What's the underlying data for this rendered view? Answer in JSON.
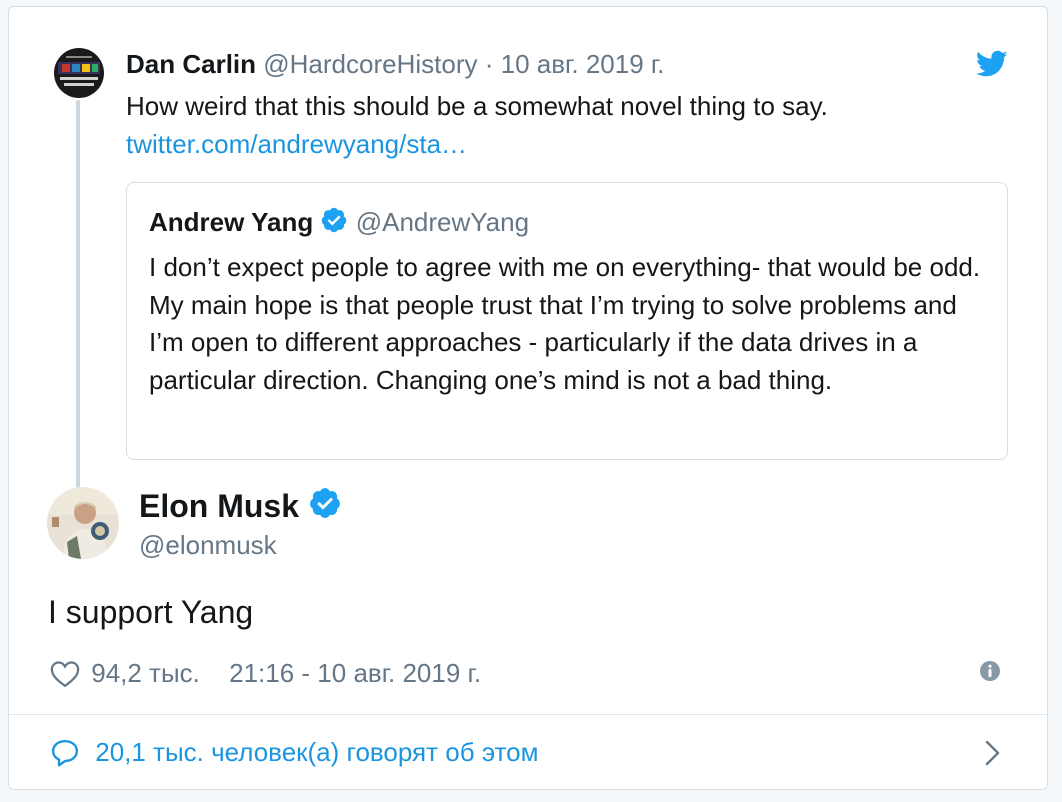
{
  "quoted_reply": {
    "author_name": "Dan Carlin",
    "author_handle": "@HardcoreHistory",
    "separator": "·",
    "date": "10 авг. 2019 г.",
    "text": "How weird that this should be a somewhat novel thing to say.",
    "link": "twitter.com/andrewyang/sta…",
    "avatar_icon": "hardcore-history-logo"
  },
  "quote": {
    "author_name": "Andrew Yang",
    "author_handle": "@AndrewYang",
    "verified": true,
    "text": "I don’t expect people to agree with me on everything- that would be odd. My main hope is that people trust that I’m trying to solve problems and I’m open to different approaches - particularly if the data drives in a particular direction. Changing one’s mind is not a bad thing."
  },
  "tweet": {
    "author_name": "Elon Musk",
    "author_handle": "@elonmusk",
    "verified": true,
    "text": "I support Yang",
    "likes": "94,2 тыс.",
    "timestamp": "21:16 - 10 авг. 2019 г."
  },
  "footer": {
    "conversation_text": "20,1 тыс. человек(а) говорят об этом"
  },
  "colors": {
    "link": "#1b95e0",
    "muted": "#657786",
    "text": "#14171a",
    "verified_badge": "#1da1f2",
    "twitter_bird": "#1da1f2"
  },
  "icons": [
    "twitter-bird-icon",
    "verified-badge-icon",
    "heart-icon",
    "info-icon",
    "comment-icon",
    "chevron-right-icon"
  ]
}
